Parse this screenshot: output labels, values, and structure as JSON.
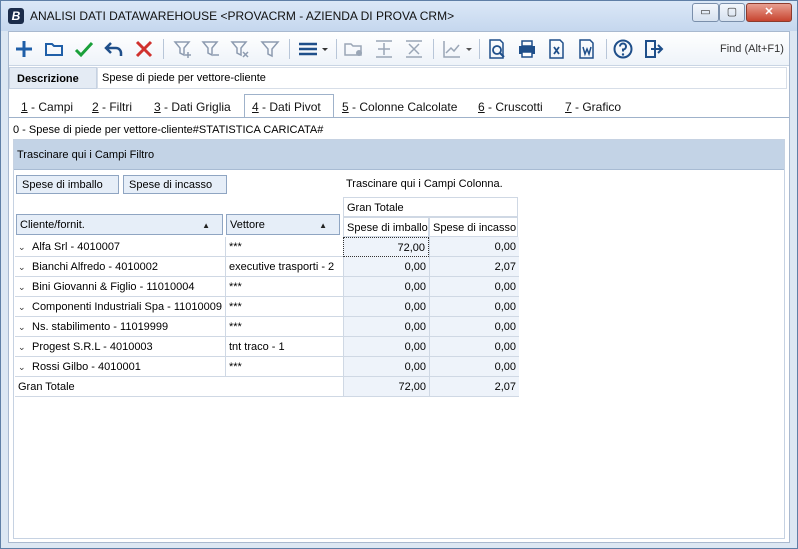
{
  "window": {
    "app_icon": "B",
    "title": "ANALISI DATI DATAWAREHOUSE <PROVACRM - AZIENDA DI PROVA CRM>",
    "buttons": {
      "minimize": "▭",
      "maximize": "▢",
      "close": "✕"
    }
  },
  "toolbar": {
    "icons": [
      "add-icon",
      "open-folder-icon",
      "confirm-check-icon",
      "undo-icon",
      "delete-x-icon",
      "filter-add-icon",
      "filter-remove-icon",
      "filter-clear-icon",
      "filter-icon",
      "menu-lines-icon",
      "folder-settings-icon",
      "add-row-icon",
      "remove-row-icon",
      "chart-icon",
      "print-preview-icon",
      "print-icon",
      "excel-export-icon",
      "word-export-icon",
      "help-icon",
      "exit-icon"
    ],
    "find_label": "Find (Alt+F1)"
  },
  "description": {
    "label": "Descrizione",
    "value": "Spese di piede per vettore-cliente"
  },
  "tabs": [
    {
      "key": "1",
      "label": " - Campi"
    },
    {
      "key": "2",
      "label": " - Filtri"
    },
    {
      "key": "3",
      "label": " - Dati Griglia"
    },
    {
      "key": "4",
      "label": " - Dati Pivot"
    },
    {
      "key": "5",
      "label": " - Colonne Calcolate"
    },
    {
      "key": "6",
      "label": " - Cruscotti"
    },
    {
      "key": "7",
      "label": " - Grafico"
    }
  ],
  "active_tab": 3,
  "status_line": "0 - Spese di piede per vettore-cliente#STATISTICA CARICATA#",
  "pivot": {
    "filter_drop_text": "Trascinare qui i Campi Filtro",
    "column_drop_text": "Trascinare qui i Campi Colonna.",
    "data_fields": [
      "Spese di imballo",
      "Spese di incasso"
    ],
    "row_headers": [
      "Cliente/fornit.",
      "Vettore"
    ],
    "grand_total_header": "Gran Totale",
    "value_headers": [
      "Spese di imballo",
      "Spese di incasso"
    ],
    "rows": [
      {
        "cliente": "Alfa Srl - 4010007",
        "vettore": "***",
        "imballo": "72,00",
        "incasso": "0,00"
      },
      {
        "cliente": "Bianchi Alfredo  - 4010002",
        "vettore": "executive trasporti - 2",
        "imballo": "0,00",
        "incasso": "2,07"
      },
      {
        "cliente": "Bini Giovanni & Figlio - 11010004",
        "vettore": "***",
        "imballo": "0,00",
        "incasso": "0,00"
      },
      {
        "cliente": "Componenti Industriali Spa - 11010009",
        "vettore": "***",
        "imballo": "0,00",
        "incasso": "0,00"
      },
      {
        "cliente": "Ns. stabilimento - 11019999",
        "vettore": "***",
        "imballo": "0,00",
        "incasso": "0,00"
      },
      {
        "cliente": "Progest S.R.L - 4010003",
        "vettore": "tnt traco - 1",
        "imballo": "0,00",
        "incasso": "0,00"
      },
      {
        "cliente": "Rossi Gilbo  - 4010001",
        "vettore": "***",
        "imballo": "0,00",
        "incasso": "0,00"
      }
    ],
    "total_label": "Gran Totale",
    "total": {
      "imballo": "72,00",
      "incasso": "2,07"
    }
  },
  "colors": {
    "accent": "#1f5fa8",
    "check": "#1aa03a",
    "delete": "#d0312d",
    "band": "#c3d3e6"
  }
}
